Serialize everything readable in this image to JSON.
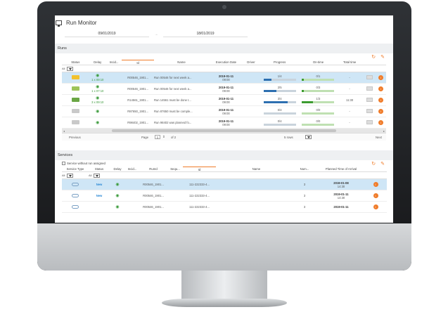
{
  "window": {
    "title": "Run Monitor"
  },
  "dates": {
    "from": "09/01/2019",
    "to": "18/01/2019"
  },
  "runs": {
    "section_title": "Runs",
    "columns": [
      "Status",
      "Delay",
      "Incid...",
      "Id",
      "Name",
      "Execution Date",
      "Driver",
      "Progress",
      "On-time",
      "Total time"
    ],
    "filter_value": "All",
    "rows": [
      {
        "delay": "1 x 09:10",
        "id": "R00546_1901...",
        "name": "Run 00546 for next week a...",
        "date": "2019-01-11",
        "time": "09:00",
        "progress": "1/4",
        "progress_value": 0.25,
        "ontime": "0/1",
        "ontime_value": 0.05,
        "total": "-",
        "truck_color": "#f2c12e"
      },
      {
        "delay": "1 x 07:10",
        "id": "R00546_1901...",
        "name": "Run 00546 for next week a...",
        "date": "2019-01-11",
        "time": "09:00",
        "progress": "2/5",
        "progress_value": 0.4,
        "ontime": "0/3",
        "ontime_value": 0.05,
        "total": "-",
        "truck_color": "#9ec45a"
      },
      {
        "delay": "3 x 09:10",
        "id": "R14561_1901...",
        "name": "Run 14561 must be done t...",
        "date": "2019-01-11",
        "time": "09:00",
        "progress": "3/4",
        "progress_value": 0.75,
        "ontime": "1/3",
        "ontime_value": 0.33,
        "total": "11:30",
        "truck_color": "#6aa644"
      },
      {
        "delay": "",
        "id": "R87650_1901...",
        "name": "Run 87650 must be comple...",
        "date": "2019-01-11",
        "time": "09:00",
        "progress": "0/4",
        "progress_value": 0,
        "ontime": "0/0",
        "ontime_value": 0,
        "total": "-",
        "truck_color": "#c9c9c9"
      },
      {
        "delay": "",
        "id": "R98402_1901...",
        "name": "Run 98402 was planned fo...",
        "date": "2019-01-11",
        "time": "09:00",
        "progress": "0/4",
        "progress_value": 0,
        "ontime": "0/0",
        "ontime_value": 0,
        "total": "-",
        "truck_color": "#c9c9c9"
      }
    ],
    "pager": {
      "previous": "Previous",
      "page_label": "Page",
      "page": "1",
      "of": "of 2",
      "rows": "5 rows",
      "next": "Next"
    }
  },
  "services": {
    "section_title": "Services",
    "checkbox_label": "Service without run assigned",
    "columns": [
      "Service Type",
      "Status",
      "Delay",
      "Incid...",
      "RunId",
      "Sequ...",
      "Id",
      "Name",
      "Num...",
      "Planned Time of Arrival"
    ],
    "filter_value": "All",
    "rows": [
      {
        "status": "New",
        "runid": "R00546_1901...",
        "id": "111-222333-4...",
        "num": "3",
        "date": "2019-01-08",
        "time": "14:30"
      },
      {
        "status": "New",
        "runid": "R00546_1901...",
        "id": "111-222333-4...",
        "num": "3",
        "date": "2019-01-11",
        "time": "14:30"
      },
      {
        "status": "",
        "runid": "R00546_1901...",
        "id": "111-222333-4...",
        "num": "3",
        "date": "2019-01-11",
        "time": ""
      }
    ]
  }
}
